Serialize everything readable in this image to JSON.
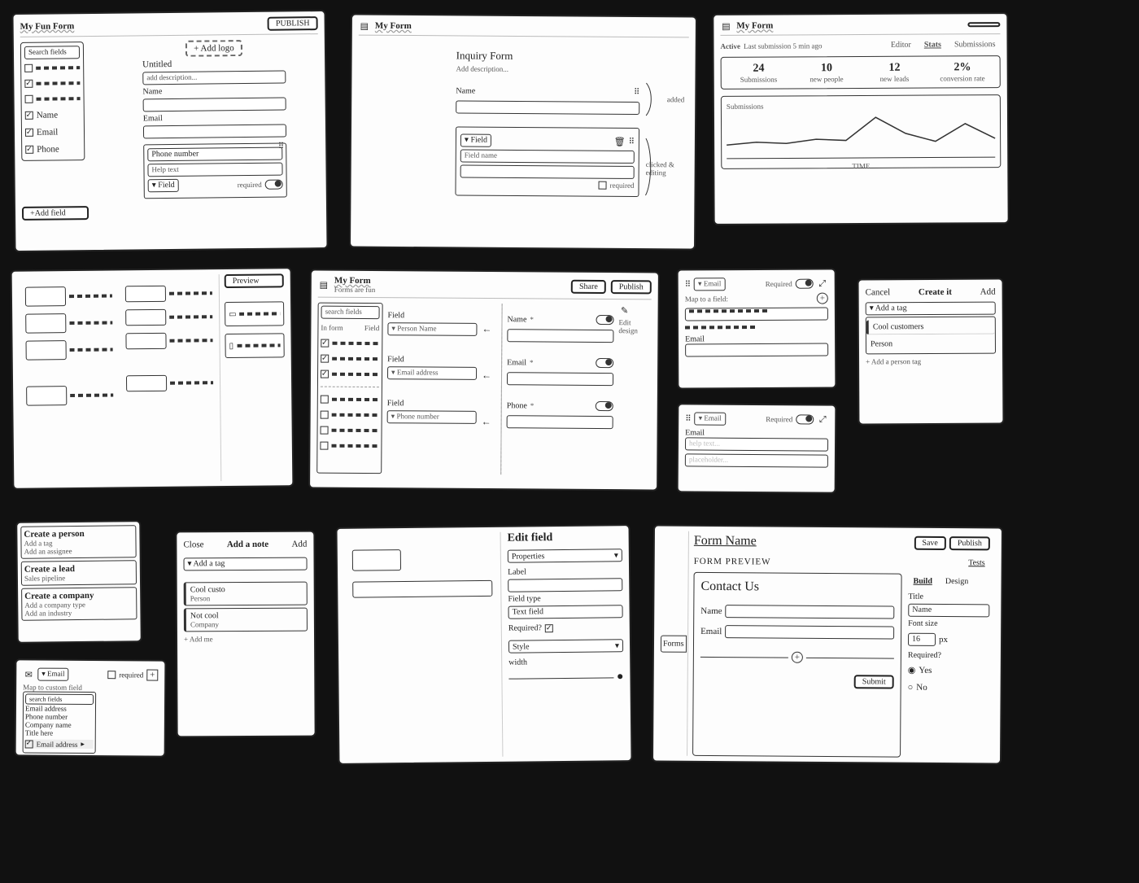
{
  "f1": {
    "title": "My Fun Form",
    "publish": "PUBLISH",
    "search_ph": "Search fields",
    "side_items": [
      "",
      "",
      "",
      "Name",
      "Email",
      "Phone"
    ],
    "add_field": "+Add field",
    "add_logo": "+ Add logo",
    "form_title": "Untitled",
    "desc_ph": "add description...",
    "labels": [
      "Name",
      "Email"
    ],
    "phone_label": "Phone number",
    "help_ph": "Help text",
    "field_dd": "Field",
    "required": "required"
  },
  "f2": {
    "title": "My Form",
    "form_title": "Inquiry Form",
    "desc_ph": "Add description...",
    "name_label": "Name",
    "note_added": "added",
    "field_dd": "Field",
    "field_name_ph": "Field name",
    "required": "required",
    "note_edit": "clicked & editing"
  },
  "f3": {
    "title": "My Form",
    "status": "Active",
    "last": "Last submission 5 min ago",
    "tabs": [
      "Editor",
      "Stats",
      "Submissions"
    ],
    "active_tab": 1,
    "stats": [
      {
        "num": "24",
        "label": "Submissions"
      },
      {
        "num": "10",
        "label": "new people"
      },
      {
        "num": "12",
        "label": "new leads"
      },
      {
        "num": "2%",
        "label": "conversion rate"
      }
    ],
    "chart_label": "Submissions",
    "xlabel": "TIME"
  },
  "chart_data": {
    "type": "line",
    "title": "Submissions",
    "xlabel": "TIME",
    "ylabel": "",
    "x": [
      0,
      1,
      2,
      3,
      4,
      5,
      6,
      7,
      8,
      9
    ],
    "values": [
      10,
      12,
      11,
      14,
      13,
      30,
      18,
      12,
      25,
      14
    ],
    "ylim": [
      0,
      35
    ]
  },
  "f4": {
    "preview": "Preview"
  },
  "f5": {
    "title": "My Form",
    "subtitle": "Forms are fun",
    "share": "Share",
    "publish": "Publish",
    "search_ph": "search fields",
    "col1": "In form",
    "col2": "Field",
    "field_label": "Field",
    "dd1": "Person Name",
    "dd2": "Email address",
    "dd3": "Phone number",
    "name": "Name",
    "email": "Email",
    "phone": "Phone",
    "edit_design": "Edit design"
  },
  "f6a": {
    "dd": "Email",
    "required": "Required",
    "map": "Map to a field:",
    "email": "Email"
  },
  "f6b": {
    "dd": "Email",
    "required": "Required",
    "label": "Email",
    "help_ph": "help text...",
    "placeholder_ph": "placeholder..."
  },
  "f7": {
    "cancel": "Cancel",
    "title": "Create it",
    "add": "Add",
    "dd": "Add a tag",
    "opts": [
      "Cool customers",
      "Person"
    ],
    "hint": "+ Add a person tag"
  },
  "f8": {
    "g1_title": "Create a person",
    "g1_lines": [
      "Add a tag",
      "Add an assignee"
    ],
    "g2_title": "Create a lead",
    "g2_lines": [
      "Sales pipeline"
    ],
    "g3_title": "Create a company",
    "g3_lines": [
      "Add a company type",
      "Add an industry"
    ]
  },
  "f9": {
    "dd": "Email",
    "required": "required",
    "map": "Map to custom field",
    "search_ph": "search fields",
    "items": [
      "Email address",
      "Phone number",
      "Company name",
      "Title here"
    ],
    "selected": "Email address"
  },
  "f10": {
    "close": "Close",
    "title": "Add a note",
    "add": "Add",
    "dd": "Add a tag",
    "t1": "Cool custo",
    "t1b": "Person",
    "t2": "Not cool",
    "t2b": "Company",
    "hint": "+ Add me"
  },
  "f11": {
    "title": "Edit field",
    "section": "Properties",
    "label_l": "Label",
    "type_l": "Field type",
    "type_v": "Text field",
    "required_l": "Required?",
    "style": "Style",
    "width": "width"
  },
  "f12": {
    "forms_tab": "Forms",
    "name": "Form Name",
    "save": "Save",
    "publish": "Publish",
    "preview": "FORM PREVIEW",
    "tests": "Tests",
    "build": "Build",
    "design": "Design",
    "contact": "Contact Us",
    "name_l": "Name",
    "email_l": "Email",
    "submit": "Submit",
    "r_title": "Title",
    "r_name": "Name",
    "r_font": "Font size",
    "r_fontv": "16",
    "r_px": "px",
    "r_req": "Required?",
    "r_yes": "Yes",
    "r_no": "No"
  }
}
